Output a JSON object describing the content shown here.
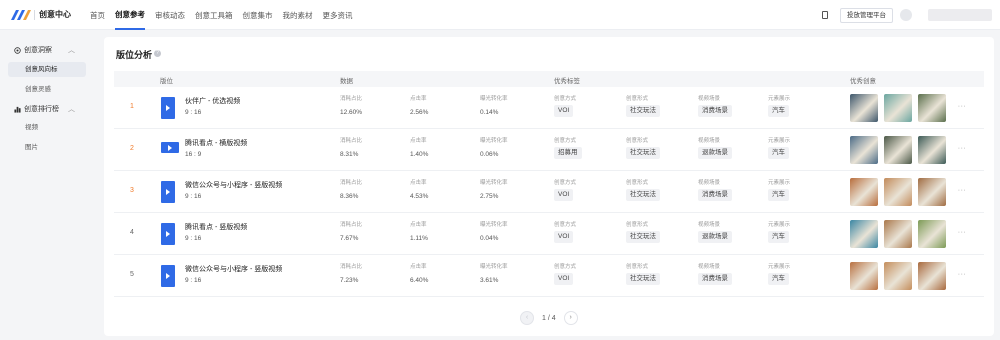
{
  "header": {
    "app_title": "创意中心",
    "nav": [
      "首页",
      "创意参考",
      "审核动态",
      "创意工具箱",
      "创意集市",
      "我的素材",
      "更多资讯"
    ],
    "active_nav": 1,
    "platform_button": "投放管理平台"
  },
  "sidebar": {
    "groups": [
      {
        "label": "创意洞察",
        "items": [
          "创意风向标",
          "创意灵感"
        ]
      },
      {
        "label": "创意排行榜",
        "items": [
          "视频",
          "图片"
        ]
      }
    ],
    "active_item": "创意风向标"
  },
  "page": {
    "title": "版位分析",
    "columns": {
      "position": "版位",
      "data": "数据",
      "labels": "优秀标签",
      "creatives": "优秀创意"
    },
    "metric_labels": [
      "消耗占比",
      "点击率",
      "曝光转化率"
    ],
    "tag_labels": [
      "创意方式",
      "创意形式",
      "视频场景",
      "元素展示"
    ],
    "rows": [
      {
        "rank": "1",
        "name": "伙伴广 - 优选视频",
        "ratio": "9 : 16",
        "metrics": [
          "12.60%",
          "2.56%",
          "0.14%"
        ],
        "tags": [
          "VOI",
          "社交玩法",
          "消费场景",
          "汽车"
        ],
        "creative_colors": [
          "#3d566b",
          "#6aa6a0",
          "#5a6f4c"
        ]
      },
      {
        "rank": "2",
        "name": "腾讯看点 - 横版视频",
        "ratio": "16 : 9",
        "metrics": [
          "8.31%",
          "1.40%",
          "0.06%"
        ],
        "tags": [
          "招募用",
          "社交玩法",
          "退款场景",
          "汽车"
        ],
        "creative_colors": [
          "#4b6b86",
          "#4a5746",
          "#3c5a56"
        ]
      },
      {
        "rank": "3",
        "name": "微信公众号与小程序 - 竖版视频",
        "ratio": "9 : 16",
        "metrics": [
          "8.36%",
          "4.53%",
          "2.75%"
        ],
        "tags": [
          "VOI",
          "社交玩法",
          "消费场景",
          "汽车"
        ],
        "creative_colors": [
          "#b86d3c",
          "#c28a5a",
          "#a06c42"
        ]
      },
      {
        "rank": "4",
        "name": "腾讯看点 - 竖版视频",
        "ratio": "9 : 16",
        "metrics": [
          "7.67%",
          "1.11%",
          "0.04%"
        ],
        "tags": [
          "VOI",
          "社交玩法",
          "退款场景",
          "汽车"
        ],
        "creative_colors": [
          "#3a86a3",
          "#a9774a",
          "#7c9a55"
        ]
      },
      {
        "rank": "5",
        "name": "微信公众号与小程序 - 竖版视频",
        "ratio": "9 : 16",
        "metrics": [
          "7.23%",
          "6.40%",
          "3.61%"
        ],
        "tags": [
          "VOI",
          "社交玩法",
          "消费场景",
          "汽车"
        ],
        "creative_colors": [
          "#b87040",
          "#c48d5b",
          "#a8693d"
        ]
      }
    ]
  },
  "pagination": {
    "text": "1 / 4",
    "prev": "‹",
    "next": "›"
  }
}
